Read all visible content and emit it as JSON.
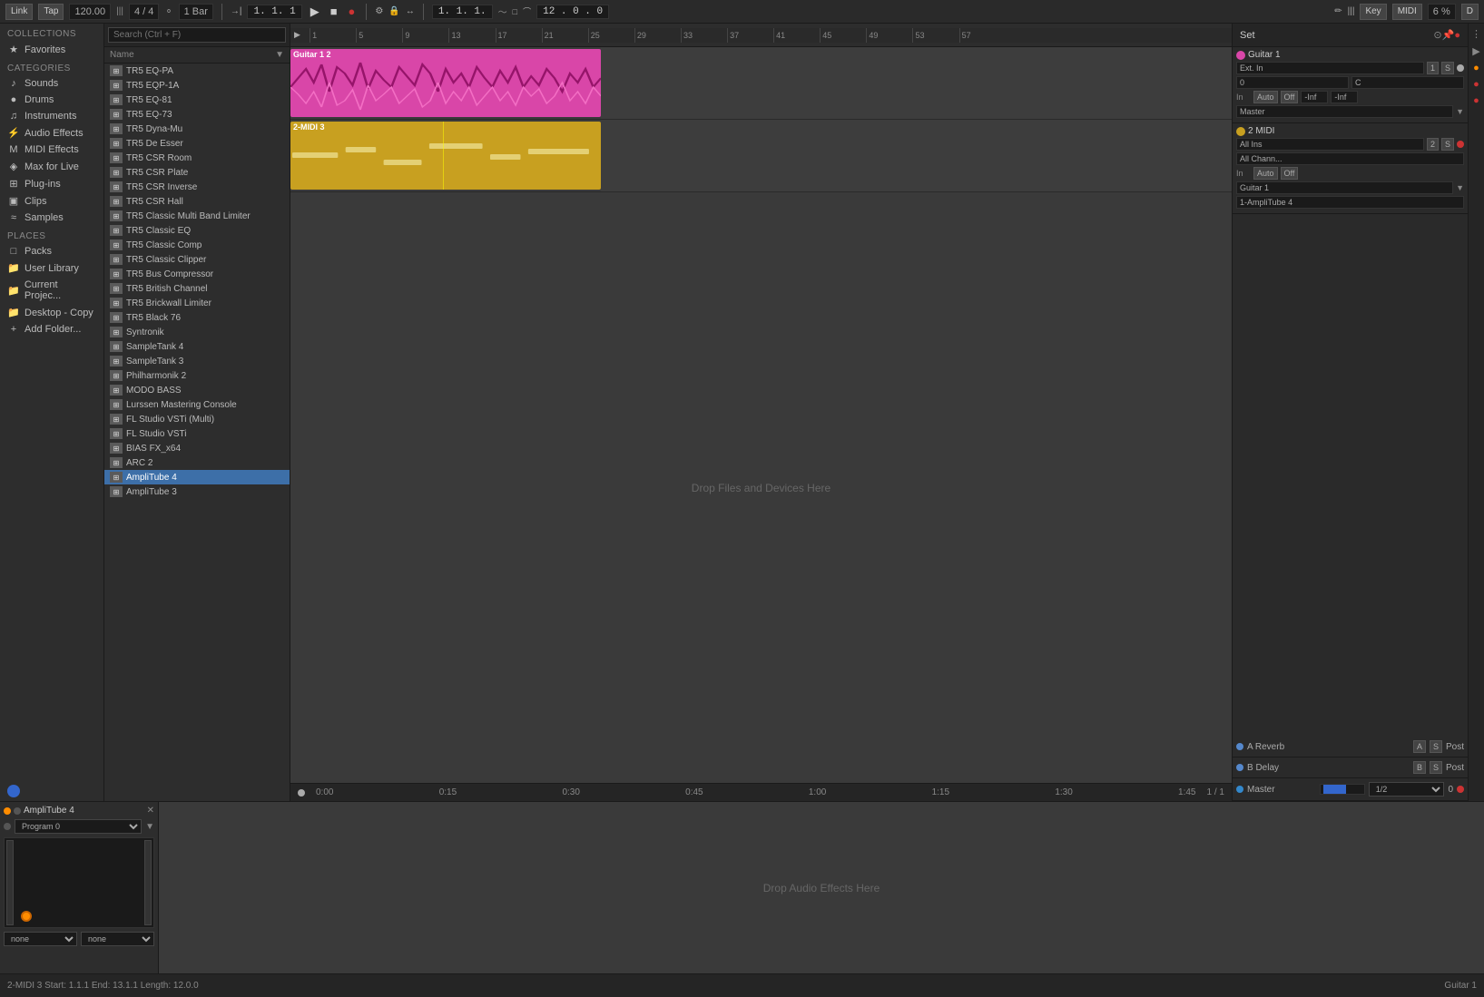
{
  "topbar": {
    "link_label": "Link",
    "tap_label": "Tap",
    "bpm": "120.00",
    "time_sig": "4 / 4",
    "quantize": "1 Bar",
    "position": "1. 1. 1",
    "key_label": "Key",
    "midi_label": "MIDI",
    "cpu": "6 %",
    "d_label": "D"
  },
  "sidebar": {
    "categories_label": "Categories",
    "collections_label": "Collections",
    "items": [
      {
        "id": "favorites",
        "label": "Favorites",
        "icon": "★"
      },
      {
        "id": "sounds",
        "label": "Sounds",
        "icon": "♪"
      },
      {
        "id": "drums",
        "label": "Drums",
        "icon": "●"
      },
      {
        "id": "instruments",
        "label": "Instruments",
        "icon": "♫"
      },
      {
        "id": "audio-effects",
        "label": "Audio Effects",
        "icon": "⚡"
      },
      {
        "id": "midi-effects",
        "label": "MIDI Effects",
        "icon": "M"
      },
      {
        "id": "max-for-live",
        "label": "Max for Live",
        "icon": "◈"
      },
      {
        "id": "plug-ins",
        "label": "Plug-ins",
        "icon": "⊞"
      },
      {
        "id": "clips",
        "label": "Clips",
        "icon": "▣"
      },
      {
        "id": "samples",
        "label": "Samples",
        "icon": "≈"
      }
    ],
    "places_label": "Places",
    "place_items": [
      {
        "id": "packs",
        "label": "Packs",
        "icon": "□"
      },
      {
        "id": "user-library",
        "label": "User Library",
        "icon": "📁"
      },
      {
        "id": "current-project",
        "label": "Current Projec...",
        "icon": "📁"
      },
      {
        "id": "desktop-copy",
        "label": "Desktop - Copy",
        "icon": "📁"
      },
      {
        "id": "add-folder",
        "label": "Add Folder...",
        "icon": "+"
      }
    ]
  },
  "browser": {
    "search_placeholder": "Search (Ctrl + F)",
    "col_header": "Name",
    "items": [
      {
        "name": "TR5 EQ-PA",
        "type": "plug"
      },
      {
        "name": "TR5 EQP-1A",
        "type": "plug"
      },
      {
        "name": "TR5 EQ-81",
        "type": "plug"
      },
      {
        "name": "TR5 EQ-73",
        "type": "plug"
      },
      {
        "name": "TR5 Dyna-Mu",
        "type": "plug"
      },
      {
        "name": "TR5 De Esser",
        "type": "plug"
      },
      {
        "name": "TR5 CSR Room",
        "type": "plug"
      },
      {
        "name": "TR5 CSR Plate",
        "type": "plug"
      },
      {
        "name": "TR5 CSR Inverse",
        "type": "plug"
      },
      {
        "name": "TR5 CSR Hall",
        "type": "plug"
      },
      {
        "name": "TR5 Classic Multi Band Limiter",
        "type": "plug"
      },
      {
        "name": "TR5 Classic EQ",
        "type": "plug"
      },
      {
        "name": "TR5 Classic Comp",
        "type": "plug"
      },
      {
        "name": "TR5 Classic Clipper",
        "type": "plug"
      },
      {
        "name": "TR5 Bus Compressor",
        "type": "plug"
      },
      {
        "name": "TR5 British Channel",
        "type": "plug"
      },
      {
        "name": "TR5 Brickwall Limiter",
        "type": "plug"
      },
      {
        "name": "TR5 Black 76",
        "type": "plug"
      },
      {
        "name": "Syntronik",
        "type": "plug"
      },
      {
        "name": "SampleTank 4",
        "type": "plug"
      },
      {
        "name": "SampleTank 3",
        "type": "plug"
      },
      {
        "name": "Philharmonik 2",
        "type": "plug"
      },
      {
        "name": "MODO BASS",
        "type": "plug"
      },
      {
        "name": "Lurssen Mastering Console",
        "type": "plug"
      },
      {
        "name": "FL Studio VSTi (Multi)",
        "type": "plug"
      },
      {
        "name": "FL Studio VSTi",
        "type": "plug"
      },
      {
        "name": "BIAS FX_x64",
        "type": "plug"
      },
      {
        "name": "ARC 2",
        "type": "plug"
      },
      {
        "name": "AmpliTube 4",
        "type": "plug",
        "selected": true
      },
      {
        "name": "AmpliTube 3",
        "type": "plug"
      }
    ]
  },
  "tracks": [
    {
      "id": "guitar-1",
      "name": "Guitar 1 2",
      "type": "audio",
      "clip_color": "#d946a8",
      "clip_start_pct": 0,
      "clip_width_pct": 33
    },
    {
      "id": "midi-3",
      "name": "2-MIDI 3",
      "type": "midi",
      "clip_color": "#c8a020",
      "clip_start_pct": 0,
      "clip_width_pct": 33
    }
  ],
  "drop_zone": {
    "label": "Drop Files and Devices Here"
  },
  "mixer": {
    "set_label": "Set",
    "channels": [
      {
        "id": "guitar-1",
        "name": "Guitar 1",
        "color": "#d946a8",
        "input": "Ext. In",
        "number": "1",
        "s_label": "S",
        "auto_label": "Auto",
        "off_label": "Off",
        "vol_label": "-Inf",
        "pan_label": "-Inf",
        "routing": "Master",
        "indicator_color": "#d946a8"
      },
      {
        "id": "midi-2",
        "name": "2 MIDI",
        "color": "#c8a020",
        "input": "All Ins",
        "number": "2",
        "s_label": "S",
        "auto_label": "Auto",
        "off_label": "Off",
        "chan": "All Chann...",
        "routing": "Guitar 1",
        "device": "1-AmpliTube 4",
        "indicator_color": "#c8a020"
      }
    ],
    "sends": [
      {
        "id": "a-reverb",
        "name": "A Reverb",
        "label": "A",
        "color": "#5588cc"
      },
      {
        "id": "b-delay",
        "name": "B Delay",
        "label": "B",
        "color": "#5588cc"
      },
      {
        "id": "master",
        "name": "Master",
        "label": "0",
        "color": "#3388cc"
      }
    ]
  },
  "device": {
    "name": "AmpliTube 4",
    "program": "Program 0",
    "knob_color": "#ff8c00",
    "dropdown1": "none",
    "dropdown2": "none"
  },
  "effects_zone": {
    "label": "Drop Audio Effects Here"
  },
  "statusbar": {
    "info": "2-MIDI 3 Start: 1.1.1 End: 13.1.1 Length: 12.0.0",
    "track_name": "Guitar 1"
  },
  "timeline": {
    "markers": [
      {
        "pos": "1",
        "left_pct": 1
      },
      {
        "pos": "5",
        "left_pct": 6
      },
      {
        "pos": "9",
        "left_pct": 11
      },
      {
        "pos": "13",
        "left_pct": 16
      },
      {
        "pos": "17",
        "left_pct": 21
      },
      {
        "pos": "21",
        "left_pct": 26
      },
      {
        "pos": "25",
        "left_pct": 31
      },
      {
        "pos": "29",
        "left_pct": 36
      },
      {
        "pos": "33",
        "left_pct": 41
      },
      {
        "pos": "37",
        "left_pct": 46
      },
      {
        "pos": "41",
        "left_pct": 51
      },
      {
        "pos": "45",
        "left_pct": 56
      },
      {
        "pos": "49",
        "left_pct": 61
      },
      {
        "pos": "53",
        "left_pct": 66
      },
      {
        "pos": "57",
        "left_pct": 71
      }
    ],
    "time_markers": [
      "0:00",
      "0:15",
      "0:30",
      "0:45",
      "1:00",
      "1:15",
      "1:30",
      "1:45"
    ]
  }
}
